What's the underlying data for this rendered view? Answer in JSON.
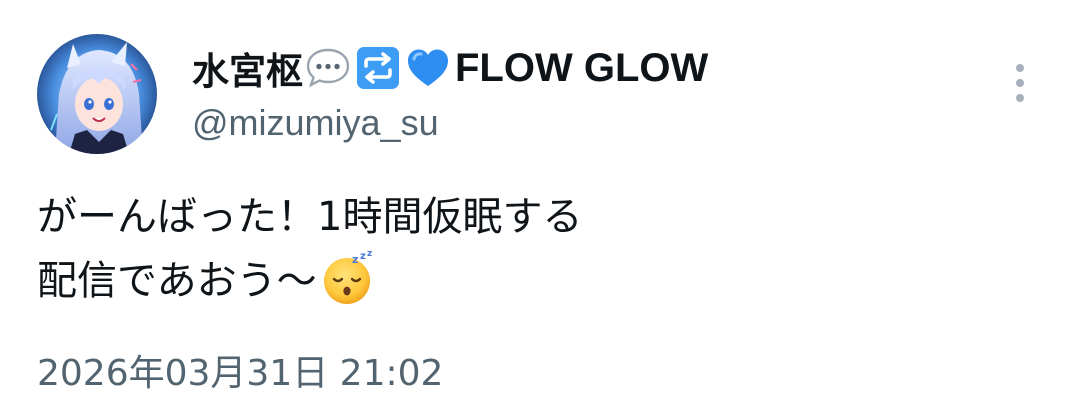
{
  "author": {
    "display_name": "水宮枢",
    "name_emojis": [
      "speech-bubble-emoji",
      "repeat-arrows-emoji",
      "blue-heart-emoji"
    ],
    "brand_name": "FLOW GLOW",
    "handle": "@mizumiya_su",
    "avatar": "anime-character-avatar"
  },
  "post": {
    "line1": "がーんばった！1時間仮眠する",
    "line2": "配信であおう〜",
    "trailing_emoji": "sleeping-face-emoji"
  },
  "timestamp": "2026年03月31日 21:02",
  "actions": {
    "more_icon": "vertical-ellipsis-icon"
  },
  "colors": {
    "text_primary": "#0f1419",
    "text_secondary": "#536471",
    "accent_blue": "#1d9bf0",
    "background": "#ffffff"
  }
}
